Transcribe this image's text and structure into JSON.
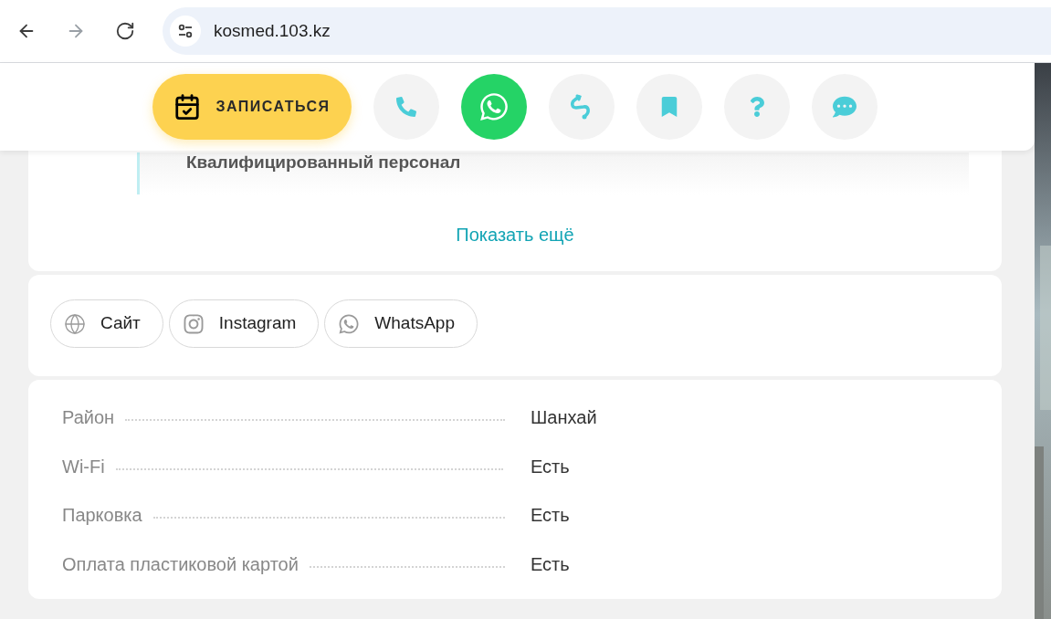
{
  "browser": {
    "nav": [
      {
        "kind": "back",
        "disabled": false
      },
      {
        "kind": "forward",
        "disabled": true
      },
      {
        "kind": "reload",
        "disabled": false
      }
    ],
    "url": "kosmed.103.kz"
  },
  "action_bar": {
    "book_button": "ЗАПИСАТЬСЯ",
    "icons": [
      {
        "kind": "phone"
      },
      {
        "kind": "whatsapp"
      },
      {
        "kind": "route"
      },
      {
        "kind": "bookmark"
      },
      {
        "kind": "question"
      },
      {
        "kind": "chat"
      }
    ]
  },
  "features": {
    "item_title": "Квалифицированный персонал",
    "show_more": "Показать ещё"
  },
  "links": [
    {
      "kind": "site",
      "label": "Сайт"
    },
    {
      "kind": "instagram",
      "label": "Instagram"
    },
    {
      "kind": "whatsapp",
      "label": "WhatsApp"
    }
  ],
  "details": [
    {
      "label": "Район",
      "value": "Шанхай"
    },
    {
      "label": "Wi-Fi",
      "value": "Есть"
    },
    {
      "label": "Парковка",
      "value": "Есть"
    },
    {
      "label": "Оплата пластиковой картой",
      "value": "Есть"
    }
  ]
}
